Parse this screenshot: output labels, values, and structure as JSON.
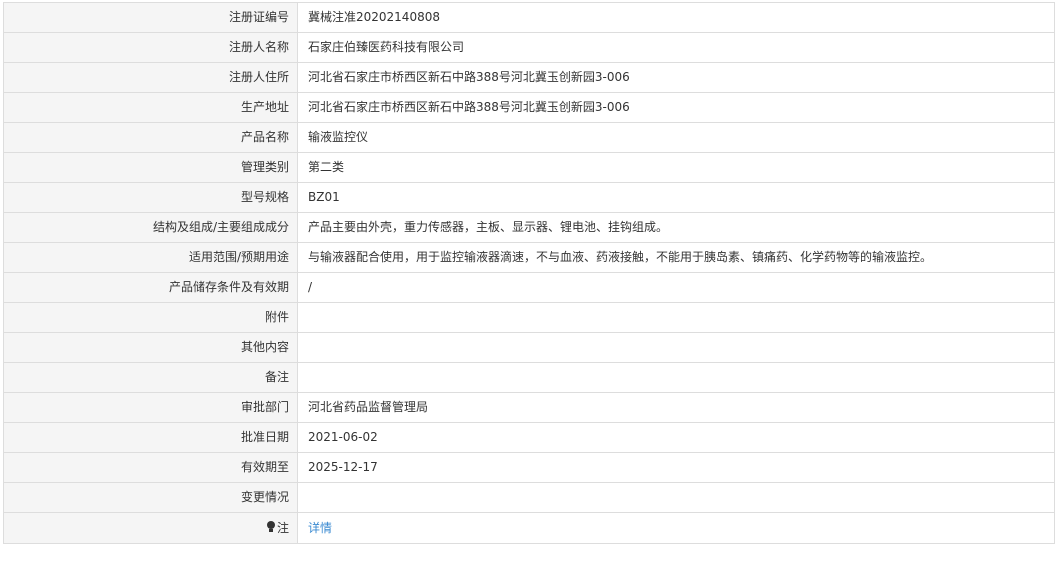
{
  "rows": [
    {
      "label": "注册证编号",
      "value": "冀械注准20202140808"
    },
    {
      "label": "注册人名称",
      "value": "石家庄伯臻医药科技有限公司"
    },
    {
      "label": "注册人住所",
      "value": "河北省石家庄市桥西区新石中路388号河北冀玉创新园3-006"
    },
    {
      "label": "生产地址",
      "value": "河北省石家庄市桥西区新石中路388号河北冀玉创新园3-006"
    },
    {
      "label": "产品名称",
      "value": "输液监控仪"
    },
    {
      "label": "管理类别",
      "value": "第二类"
    },
    {
      "label": "型号规格",
      "value": "BZ01"
    },
    {
      "label": "结构及组成/主要组成成分",
      "value": "产品主要由外壳，重力传感器，主板、显示器、锂电池、挂钩组成。"
    },
    {
      "label": "适用范围/预期用途",
      "value": "与输液器配合使用，用于监控输液器滴速，不与血液、药液接触，不能用于胰岛素、镇痛药、化学药物等的输液监控。"
    },
    {
      "label": "产品储存条件及有效期",
      "value": "/"
    },
    {
      "label": "附件",
      "value": ""
    },
    {
      "label": "其他内容",
      "value": ""
    },
    {
      "label": "备注",
      "value": ""
    },
    {
      "label": "审批部门",
      "value": "河北省药品监督管理局"
    },
    {
      "label": "批准日期",
      "value": "2021-06-02"
    },
    {
      "label": "有效期至",
      "value": "2025-12-17"
    },
    {
      "label": "变更情况",
      "value": ""
    }
  ],
  "note": {
    "icon": "lightbulb-icon",
    "label": "注",
    "link_text": "详情",
    "link_color": "#3a8ad1"
  },
  "colors": {
    "label_bg": "#f5f5f5",
    "border": "#dddddd",
    "text": "#333333"
  }
}
